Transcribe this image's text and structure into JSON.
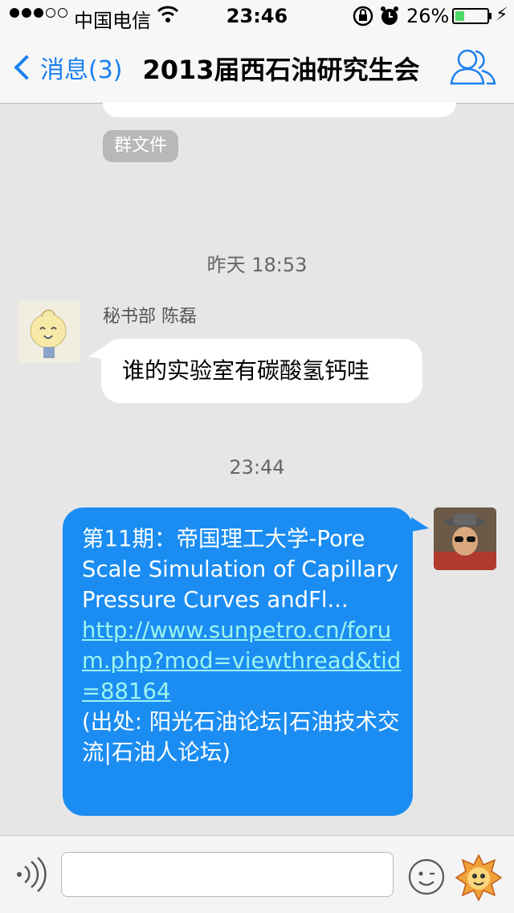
{
  "status_bar": {
    "carrier": "中国电信",
    "time": "23:46",
    "battery_percent_text": "26%",
    "battery_level": 0.26,
    "signal_bars_filled": 3,
    "signal_bars_total": 5
  },
  "nav": {
    "back_label": "消息(3)",
    "title": "2013届西石油研究生会"
  },
  "chat": {
    "group_file_chip": "群文件",
    "timestamp_1": "昨天 18:53",
    "incoming": {
      "sender": "秘书部 陈磊",
      "text": "谁的实验室有碳酸氢钙哇"
    },
    "timestamp_2": "23:44",
    "outgoing": {
      "text_before_link": "第11期：帝国理工大学-Pore Scale Simulation of Capillary Pressure Curves andFl...",
      "link": "http://www.sunpetro.cn/forum.php?mod=viewthread&tid=88164",
      "text_after_link": "(出处: 阳光石油论坛|石油技术交流|石油人论坛)"
    }
  },
  "colors": {
    "accent": "#1a7ff0",
    "outgoing_bubble": "#1b8df2",
    "link": "#9cf5f0",
    "battery_fill": "#4cd964",
    "background": "#e6e6e6"
  },
  "icons": [
    "wifi-icon",
    "orientation-lock-icon",
    "alarm-icon",
    "battery-icon",
    "charging-icon",
    "back-chevron-icon",
    "group-members-icon",
    "voice-icon",
    "emoji-icon",
    "sticker-icon"
  ]
}
